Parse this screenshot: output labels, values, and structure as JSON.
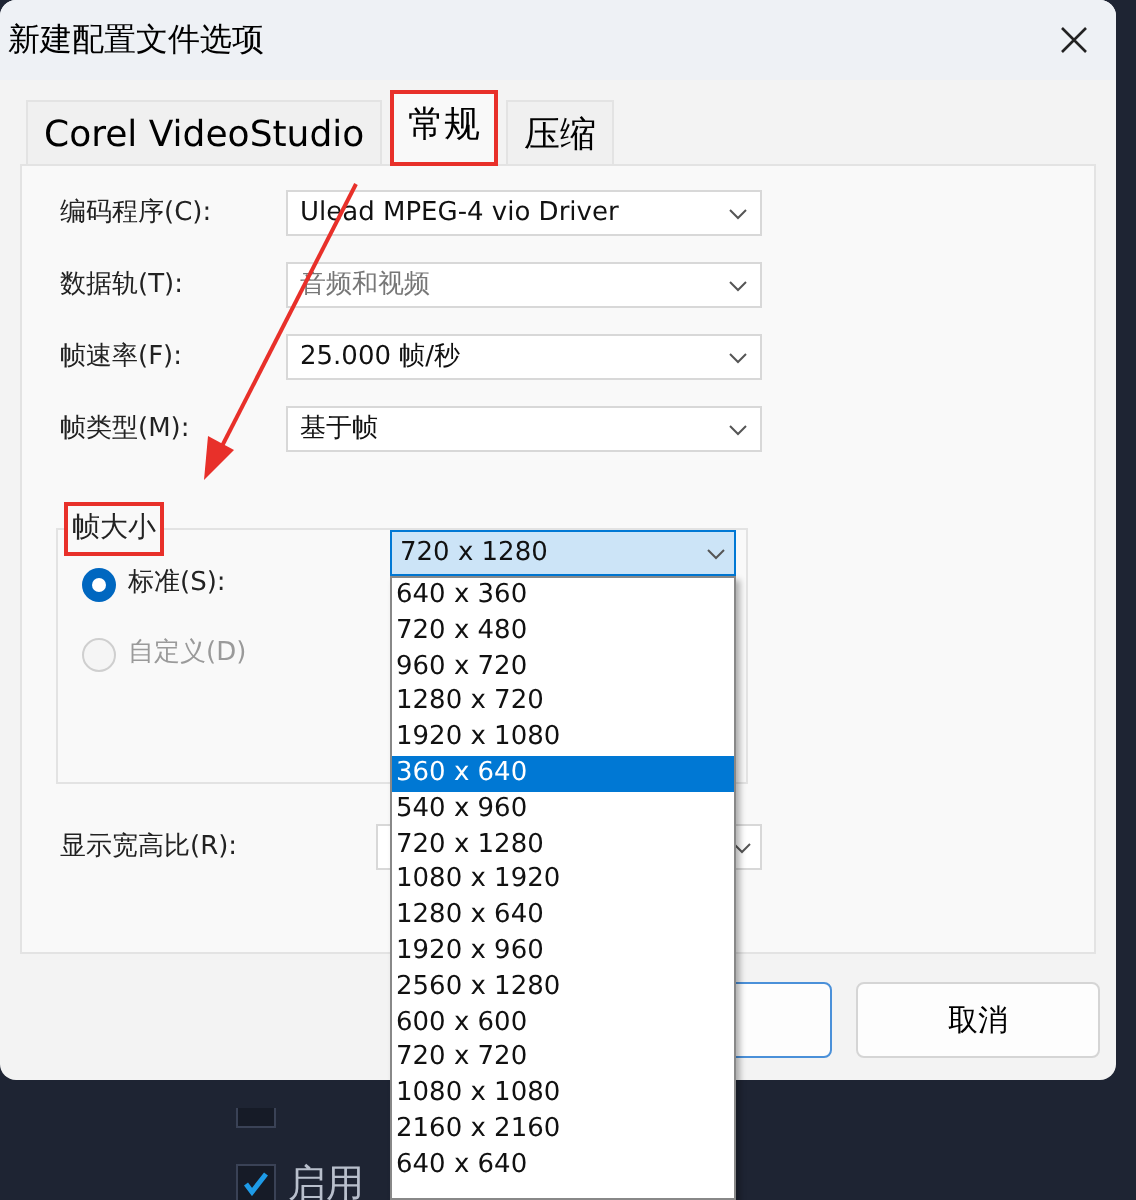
{
  "dialog": {
    "title": "新建配置文件选项",
    "tabs": [
      {
        "label": "Corel VideoStudio",
        "selected": false
      },
      {
        "label": "常规",
        "selected": true,
        "highlighted": true
      },
      {
        "label": "压缩",
        "selected": false
      }
    ],
    "fields": [
      {
        "label": "编码程序(C):",
        "value": "Ulead MPEG-4 vio Driver",
        "disabled": false
      },
      {
        "label": "数据轨(T):",
        "value": "音频和视频",
        "disabled": true
      },
      {
        "label": "帧速率(F):",
        "value": "25.000 帧/秒",
        "disabled": false
      },
      {
        "label": "帧类型(M):",
        "value": "基于帧",
        "disabled": false
      }
    ],
    "frame_size": {
      "title": "帧大小",
      "highlighted": true,
      "options": [
        {
          "label": "标准(S):",
          "selected": true,
          "disabled": false
        },
        {
          "label": "自定义(D)",
          "selected": false,
          "disabled": true
        }
      ],
      "standard_value": "720 x 1280"
    },
    "aspect_label": "显示宽高比(R):",
    "dropdown_items": [
      {
        "label": "640 x 360",
        "selected": false
      },
      {
        "label": "720 x 480",
        "selected": false
      },
      {
        "label": "960 x 720",
        "selected": false
      },
      {
        "label": "1280 x 720",
        "selected": false
      },
      {
        "label": "1920 x 1080",
        "selected": false
      },
      {
        "label": "360 x 640",
        "selected": true
      },
      {
        "label": "540 x 960",
        "selected": false
      },
      {
        "label": "720 x 1280",
        "selected": false
      },
      {
        "label": "1080 x 1920",
        "selected": false
      },
      {
        "label": "1280 x 640",
        "selected": false
      },
      {
        "label": "1920 x 960",
        "selected": false
      },
      {
        "label": "2560 x 1280",
        "selected": false
      },
      {
        "label": "600 x 600",
        "selected": false
      },
      {
        "label": "720 x 720",
        "selected": false
      },
      {
        "label": "1080 x 1080",
        "selected": false
      },
      {
        "label": "2160 x 2160",
        "selected": false
      },
      {
        "label": "640 x 640",
        "selected": false
      }
    ],
    "cancel_button": "取消"
  },
  "background": {
    "checkboxes": [
      {
        "kind": "cut",
        "checked": false
      },
      {
        "kind": "full",
        "label": "启用",
        "checked": true
      }
    ]
  }
}
